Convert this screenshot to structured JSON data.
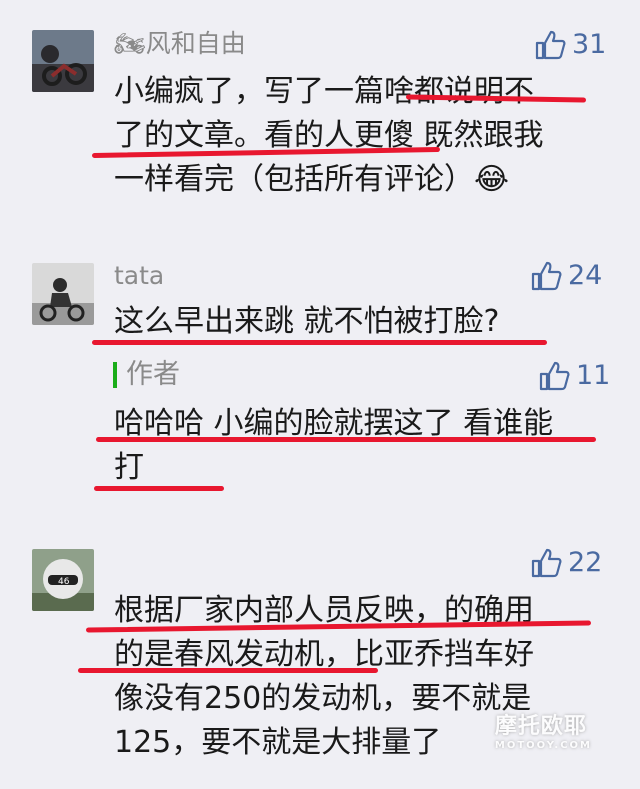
{
  "comments": [
    {
      "nickname": "🏍风和自由",
      "likes": "31",
      "lines": [
        "小编疯了，写了一篇啥都说明不",
        "了的文章。看的人更傻 既然跟我",
        "一样看完（包括所有评论）😂"
      ]
    },
    {
      "nickname": "tata",
      "likes": "24",
      "lines": [
        "这么早出来跳 就不怕被打脸?"
      ],
      "reply": {
        "author_label": "作者",
        "likes": "11",
        "lines": [
          "哈哈哈 小编的脸就摆这了 看谁能",
          "打"
        ]
      }
    },
    {
      "nickname": "",
      "likes": "22",
      "lines": [
        "根据厂家内部人员反映，的确用",
        "的是春风发动机，比亚乔挡车好",
        "像没有250的发动机，要不就是",
        "125，要不就是大排量了"
      ]
    }
  ],
  "watermark": {
    "main": "摩托欧耶",
    "sub": "MOTOOY.COM"
  },
  "colors": {
    "like": "#4a6aa1",
    "underline": "#e8172f",
    "author_bar": "#1aad19"
  }
}
